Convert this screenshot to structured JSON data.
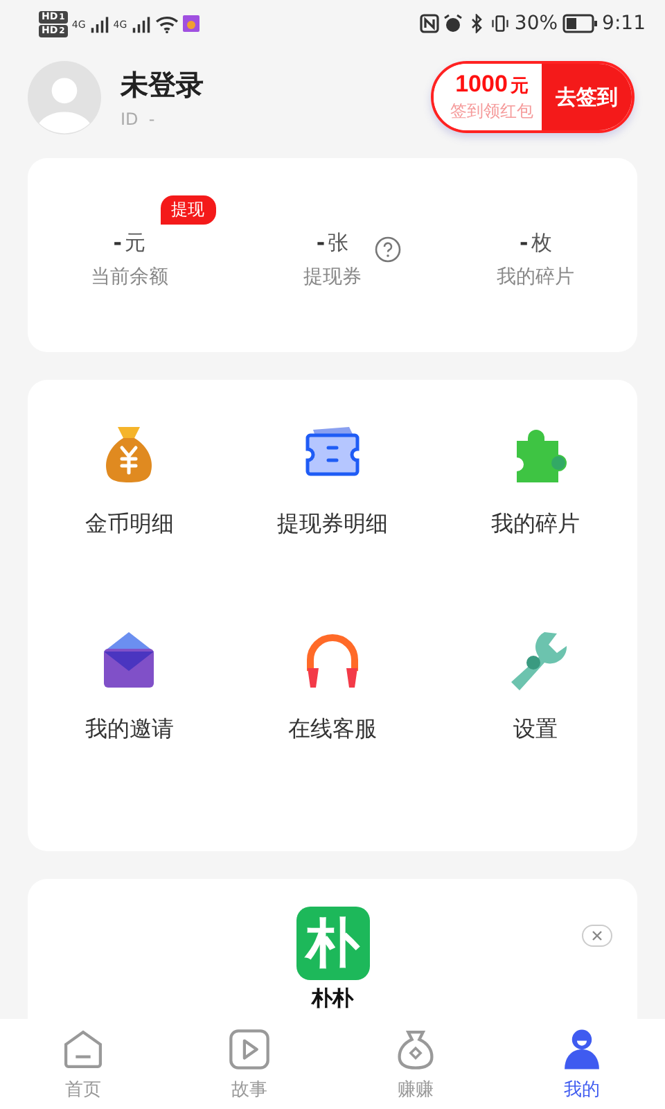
{
  "status_bar": {
    "sims": [
      {
        "hd": "HD",
        "slot": "1",
        "network": "4G"
      },
      {
        "hd": "HD",
        "slot": "2",
        "network": "4G"
      }
    ],
    "battery": "30%",
    "time": "9:11"
  },
  "profile": {
    "name": "未登录",
    "id": "ID  -"
  },
  "signin": {
    "amount": "1000",
    "unit": "元",
    "subtitle": "签到领红包",
    "button": "去签到"
  },
  "stats": [
    {
      "value": "-",
      "unit": "元",
      "label": "当前余额",
      "badge": "提现",
      "help": false
    },
    {
      "value": "-",
      "unit": "张",
      "label": "提现券",
      "help": true
    },
    {
      "value": "-",
      "unit": "枚",
      "label": "我的碎片",
      "help": false
    }
  ],
  "menu": [
    {
      "label": "金币明细",
      "kind": "money-bag"
    },
    {
      "label": "提现券明细",
      "kind": "ticket"
    },
    {
      "label": "我的碎片",
      "kind": "puzzle"
    },
    {
      "label": "我的邀请",
      "kind": "envelope"
    },
    {
      "label": "在线客服",
      "kind": "headphones"
    },
    {
      "label": "设置",
      "kind": "wrench"
    }
  ],
  "ad": {
    "logo": "朴",
    "name": "朴朴"
  },
  "tabs": [
    {
      "label": "首页",
      "kind": "home",
      "selected": false
    },
    {
      "label": "故事",
      "kind": "play",
      "selected": false
    },
    {
      "label": "赚赚",
      "kind": "bag",
      "selected": false
    },
    {
      "label": "我的",
      "kind": "person",
      "selected": true
    }
  ]
}
